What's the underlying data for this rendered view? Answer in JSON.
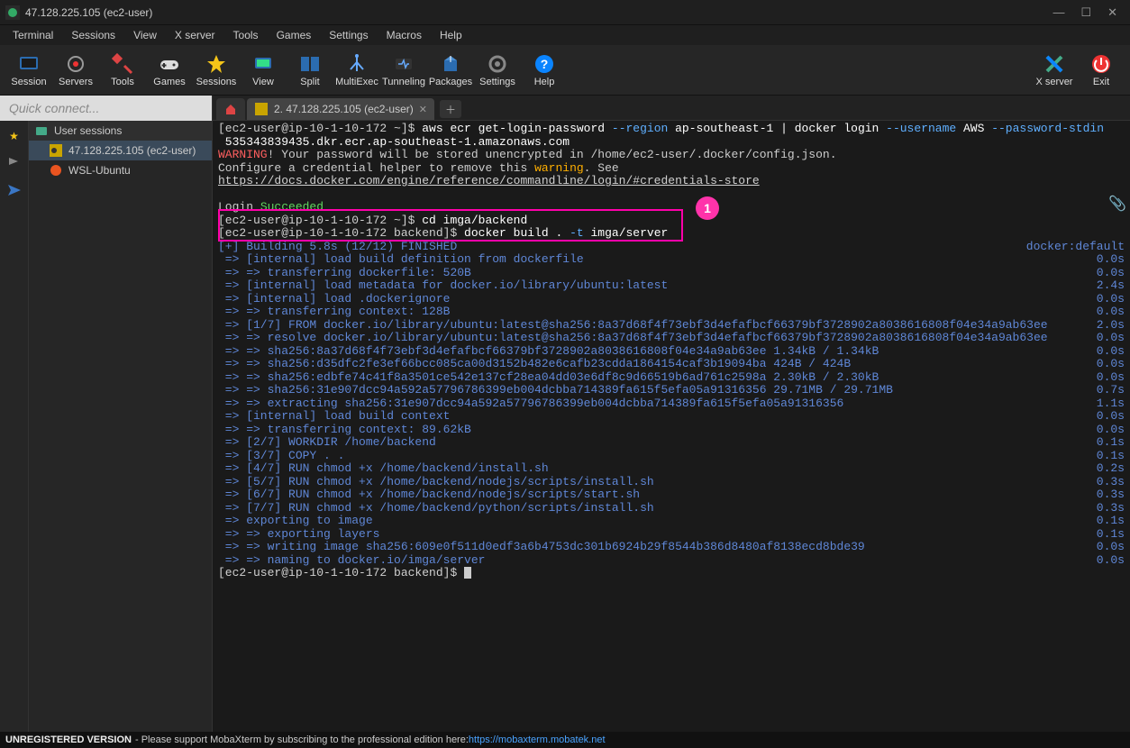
{
  "window": {
    "title": "47.128.225.105 (ec2-user)"
  },
  "menu": [
    "Terminal",
    "Sessions",
    "View",
    "X server",
    "Tools",
    "Games",
    "Settings",
    "Macros",
    "Help"
  ],
  "toolbar": {
    "left": [
      {
        "label": "Session",
        "name": "session-button"
      },
      {
        "label": "Servers",
        "name": "servers-button"
      },
      {
        "label": "Tools",
        "name": "tools-button"
      },
      {
        "label": "Games",
        "name": "games-button"
      },
      {
        "label": "Sessions",
        "name": "sessions-button"
      },
      {
        "label": "View",
        "name": "view-button"
      },
      {
        "label": "Split",
        "name": "split-button"
      },
      {
        "label": "MultiExec",
        "name": "multiexec-button"
      },
      {
        "label": "Tunneling",
        "name": "tunneling-button"
      },
      {
        "label": "Packages",
        "name": "packages-button"
      },
      {
        "label": "Settings",
        "name": "settings-button"
      },
      {
        "label": "Help",
        "name": "help-button"
      }
    ],
    "right": [
      {
        "label": "X server",
        "name": "xserver-button"
      },
      {
        "label": "Exit",
        "name": "exit-button"
      }
    ]
  },
  "sidebar": {
    "quick_connect_placeholder": "Quick connect...",
    "root_label": "User sessions",
    "items": [
      {
        "label": "47.128.225.105 (ec2-user)",
        "selected": true,
        "kind": "ssh"
      },
      {
        "label": "WSL-Ubuntu",
        "selected": false,
        "kind": "wsl"
      }
    ]
  },
  "tabs": {
    "items": [
      {
        "label": "",
        "icon": "home",
        "name": "tab-home"
      },
      {
        "label": "2. 47.128.225.105 (ec2-user)",
        "icon": "ssh",
        "active": true,
        "name": "tab-ssh-1"
      }
    ]
  },
  "annotation": {
    "badge": "1"
  },
  "terminal": {
    "docker_label": "docker:default",
    "prompt1_a": "[ec2-user@ip-10-1-10-172 ~]$ ",
    "prompt1_cmd": "aws ecr get-login-password ",
    "prompt1_opt1": "--region",
    "prompt1_mid": " ap-southeast-1 | docker login ",
    "prompt1_opt2": "--username",
    "prompt1_mid2": " AWS ",
    "prompt1_opt3": "--password-stdin",
    "ecr": " 535343839435.dkr.ecr.ap-southeast-1.amazonaws.com",
    "warn_word": "WARNING",
    "warn_rest": "! Your password will be stored unencrypted in /home/ec2-user/.docker/config.json.",
    "cfg": "Configure a credential helper to remove this ",
    "cfg_warn": "warning",
    "cfg_rest": ". See",
    "doclink": "https://docs.docker.com/engine/reference/commandline/login/#credentials-store",
    "login": "Login ",
    "login_ok": "Succeeded",
    "p_cd_prompt": "[ec2-user@ip-10-1-10-172 ~]$ ",
    "p_cd_cmd": "cd imga/backend",
    "p_build_prompt": "[ec2-user@ip-10-1-10-172 backend]$ ",
    "p_build_cmd": "docker build . ",
    "p_build_opt": "-t",
    "p_build_rest": " imga/server",
    "build_line": "[+] Building 5.8s (12/12) FINISHED",
    "steps": [
      {
        "t": " => [internal] load build definition from dockerfile",
        "r": "0.0s"
      },
      {
        "t": " => => transferring dockerfile: 520B",
        "r": "0.0s"
      },
      {
        "t": " => [internal] load metadata for docker.io/library/ubuntu:latest",
        "r": "2.4s"
      },
      {
        "t": " => [internal] load .dockerignore",
        "r": "0.0s"
      },
      {
        "t": " => => transferring context: 128B",
        "r": "0.0s"
      },
      {
        "t": " => [1/7] FROM docker.io/library/ubuntu:latest@sha256:8a37d68f4f73ebf3d4efafbcf66379bf3728902a8038616808f04e34a9ab63ee",
        "r": "2.0s"
      },
      {
        "t": " => => resolve docker.io/library/ubuntu:latest@sha256:8a37d68f4f73ebf3d4efafbcf66379bf3728902a8038616808f04e34a9ab63ee",
        "r": "0.0s"
      },
      {
        "t": " => => sha256:8a37d68f4f73ebf3d4efafbcf66379bf3728902a8038616808f04e34a9ab63ee 1.34kB / 1.34kB",
        "r": "0.0s"
      },
      {
        "t": " => => sha256:d35dfc2fe3ef66bcc085ca00d3152b482e6cafb23cdda1864154caf3b19094ba 424B / 424B",
        "r": "0.0s"
      },
      {
        "t": " => => sha256:edbfe74c41f8a3501ce542e137cf28ea04dd03e6df8c9d66519b6ad761c2598a 2.30kB / 2.30kB",
        "r": "0.0s"
      },
      {
        "t": " => => sha256:31e907dcc94a592a57796786399eb004dcbba714389fa615f5efa05a91316356 29.71MB / 29.71MB",
        "r": "0.7s"
      },
      {
        "t": " => => extracting sha256:31e907dcc94a592a57796786399eb004dcbba714389fa615f5efa05a91316356",
        "r": "1.1s"
      },
      {
        "t": " => [internal] load build context",
        "r": "0.0s"
      },
      {
        "t": " => => transferring context: 89.62kB",
        "r": "0.0s"
      },
      {
        "t": " => [2/7] WORKDIR /home/backend",
        "r": "0.1s"
      },
      {
        "t": " => [3/7] COPY . .",
        "r": "0.1s"
      },
      {
        "t": " => [4/7] RUN chmod +x /home/backend/install.sh",
        "r": "0.2s"
      },
      {
        "t": " => [5/7] RUN chmod +x /home/backend/nodejs/scripts/install.sh",
        "r": "0.3s"
      },
      {
        "t": " => [6/7] RUN chmod +x /home/backend/nodejs/scripts/start.sh",
        "r": "0.3s"
      },
      {
        "t": " => [7/7] RUN chmod +x /home/backend/python/scripts/install.sh",
        "r": "0.3s"
      },
      {
        "t": " => exporting to image",
        "r": "0.1s"
      },
      {
        "t": " => => exporting layers",
        "r": "0.1s"
      },
      {
        "t": " => => writing image sha256:609e0f511d0edf3a6b4753dc301b6924b29f8544b386d8480af8138ecd8bde39",
        "r": "0.0s"
      },
      {
        "t": " => => naming to docker.io/imga/server",
        "r": "0.0s"
      }
    ],
    "final_prompt": "[ec2-user@ip-10-1-10-172 backend]$ "
  },
  "statusbar": {
    "unreg": "UNREGISTERED VERSION",
    "text": " -  Please support MobaXterm by subscribing to the professional edition here:  ",
    "link": "https://mobaxterm.mobatek.net"
  }
}
